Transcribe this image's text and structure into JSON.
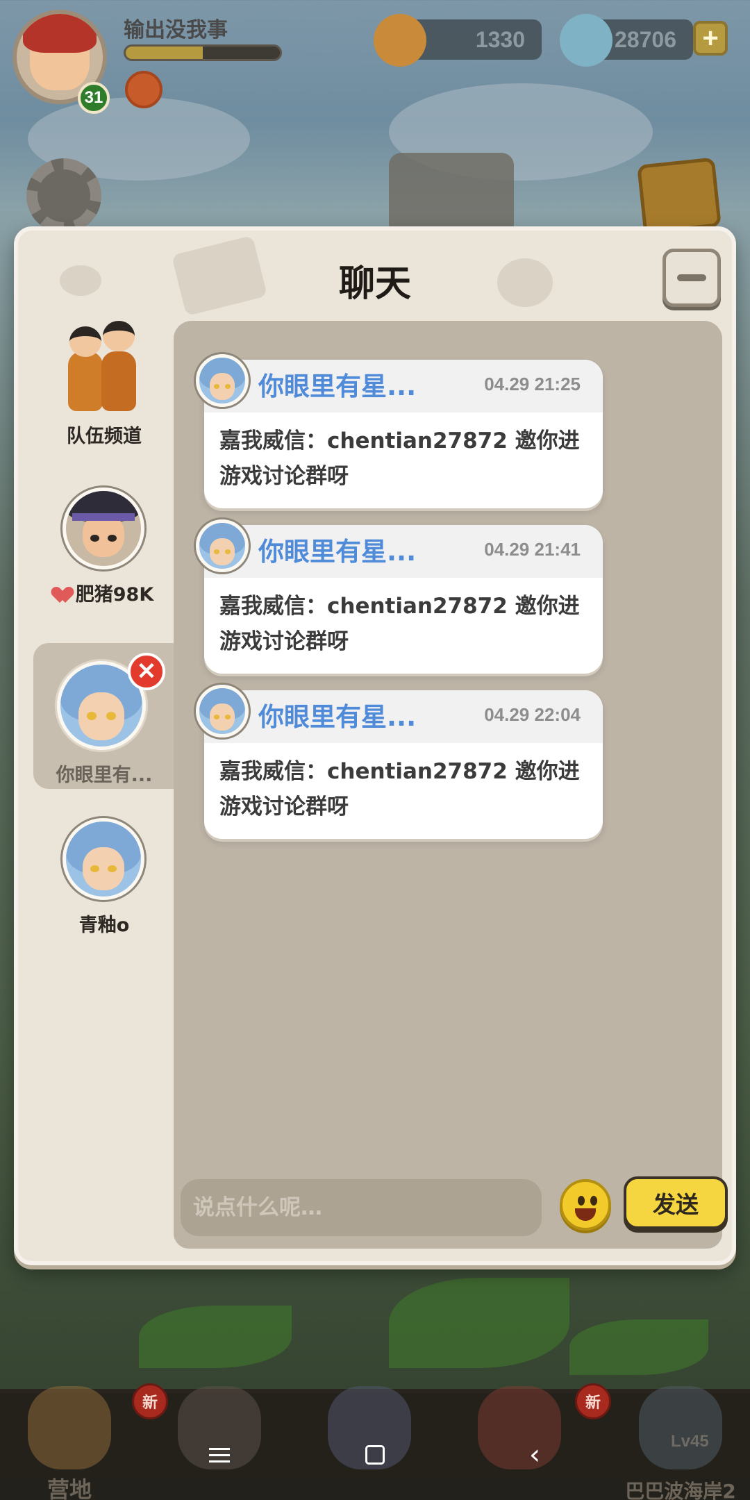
{
  "hud": {
    "player_name": "输出没我事",
    "level": "31",
    "xp_fraction": 0.5,
    "gold": "1330",
    "gems": "28706",
    "plus": "+"
  },
  "chat": {
    "title": "聊天",
    "sidebar": [
      {
        "label": "队伍频道"
      },
      {
        "label": "肥猪98K"
      },
      {
        "label": "你眼里有..."
      },
      {
        "label": "青釉o"
      }
    ],
    "remove_glyph": "✕",
    "messages": [
      {
        "name": "你眼里有星...",
        "time": "04.29 21:25",
        "text": "嘉我威信：chentian27872 邀你进游戏讨论群呀"
      },
      {
        "name": "你眼里有星...",
        "time": "04.29 21:41",
        "text": "嘉我威信：chentian27872 邀你进游戏讨论群呀"
      },
      {
        "name": "你眼里有星...",
        "time": "04.29 22:04",
        "text": "嘉我威信：chentian27872 邀你进游戏讨论群呀"
      }
    ],
    "input": {
      "placeholder": "说点什么呢…",
      "value": ""
    },
    "send_label": "发送"
  },
  "bottom_bar": {
    "tabs": [
      {
        "label": "营地",
        "new": "新"
      },
      {
        "label": ""
      },
      {
        "label": ""
      },
      {
        "label": "",
        "new": "新"
      },
      {
        "label": "巴巴波海岸2",
        "lock": "Lv45"
      }
    ]
  },
  "colors": {
    "accent_name": "#4f8bd9",
    "send_button": "#f5d640",
    "remove_badge": "#e33a2e"
  }
}
